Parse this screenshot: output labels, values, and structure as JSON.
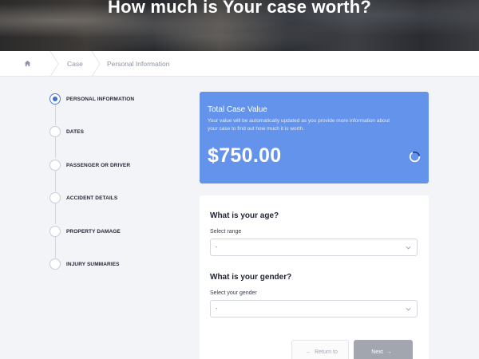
{
  "hero": {
    "title": "How much is Your case worth?"
  },
  "breadcrumb": {
    "home_icon": "home-icon",
    "items": [
      "Case",
      "Personal Information"
    ]
  },
  "stepper": {
    "steps": [
      {
        "label": "PERSONAL INFORMATION",
        "active": true
      },
      {
        "label": "DATES",
        "active": false
      },
      {
        "label": "PASSENGER OR DRIVER",
        "active": false
      },
      {
        "label": "ACCIDENT DETAILS",
        "active": false
      },
      {
        "label": "PROPERTY DAMAGE",
        "active": false
      },
      {
        "label": "INJURY SUMMARIES",
        "active": false
      }
    ]
  },
  "value_card": {
    "title": "Total Case Value",
    "description": "Your value will be automatically updated as you provide more information about your case to find out how much it is worth.",
    "amount": "$750.00",
    "color": "#6393ea"
  },
  "form": {
    "age": {
      "question": "What is your age?",
      "label": "Select range",
      "value": "-"
    },
    "gender": {
      "question": "What is your gender?",
      "label": "Select your gender",
      "value": "-"
    }
  },
  "buttons": {
    "return": {
      "label": "Return to",
      "icon": "arrow-left-icon"
    },
    "next": {
      "label": "Next",
      "icon": "arrow-right-icon"
    }
  }
}
